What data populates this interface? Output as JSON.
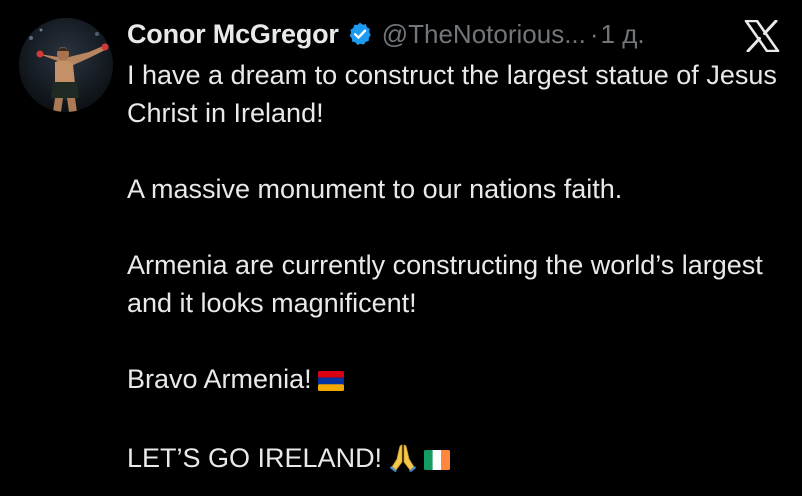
{
  "tweet": {
    "author": {
      "display_name": "Conor McGregor",
      "handle": "@TheNotorious...",
      "verified": true,
      "avatar": "avatar-fighter-photo"
    },
    "separator": "·",
    "time": "1 д.",
    "platform_icon": "x-logo-icon",
    "lines": [
      "I have a dream to construct the largest statue of Jesus Christ in Ireland!",
      "A massive monument to our nations faith.",
      "Armenia are currently constructing the world’s largest and it looks magnificent!",
      "Bravo Armenia!",
      "LET’S GO IRELAND!"
    ],
    "emoji": {
      "armenia_flag": "flag-armenia-icon",
      "praying_hands": "praying-hands-icon",
      "ireland_flag": "flag-ireland-icon"
    }
  },
  "colors": {
    "background": "#000000",
    "text": "#e7e9ea",
    "secondary": "#71767b",
    "verified": "#1d9bf0"
  }
}
